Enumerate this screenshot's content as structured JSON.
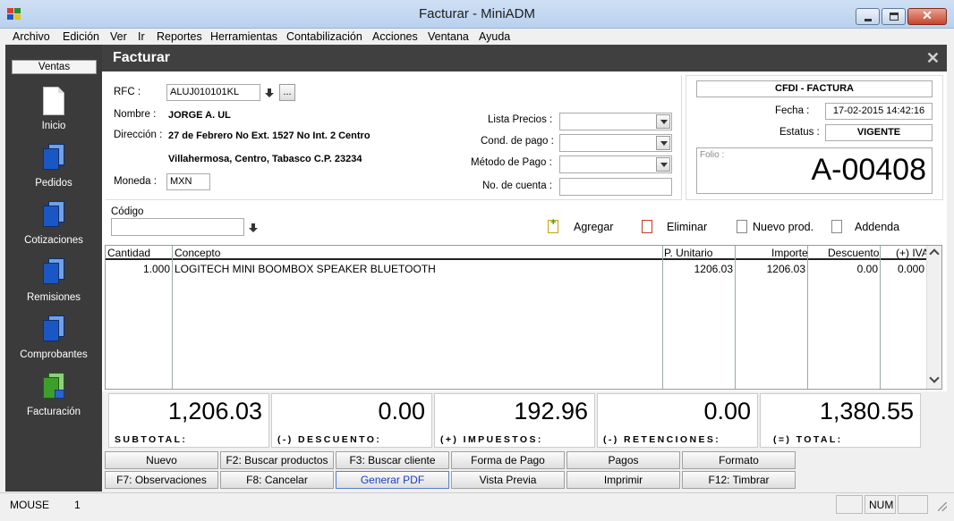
{
  "window": {
    "title": "Facturar - MiniADM"
  },
  "menu": [
    "Archivo",
    "Edición",
    "Ver",
    "Ir",
    "Reportes",
    "Herramientas",
    "Contabilización",
    "Acciones",
    "Ventana",
    "Ayuda"
  ],
  "sidebar": {
    "header": "Ventas",
    "items": [
      {
        "label": "Inicio",
        "icon": "document-icon"
      },
      {
        "label": "Pedidos",
        "icon": "pages-icon"
      },
      {
        "label": "Cotizaciones",
        "icon": "pages-icon"
      },
      {
        "label": "Remisiones",
        "icon": "pages-icon"
      },
      {
        "label": "Comprobantes",
        "icon": "pages-icon"
      },
      {
        "label": "Facturación",
        "icon": "invoice-icon"
      }
    ]
  },
  "page": {
    "title": "Facturar",
    "close_glyph": "✕"
  },
  "customer": {
    "rfc_label": "RFC :",
    "rfc": "ALUJ010101KL",
    "browse_label": "...",
    "name_label": "Nombre :",
    "name": "JORGE A. UL",
    "address_label": "Dirección :",
    "address_line1": "27 de Febrero No Ext. 1527 No Int. 2 Centro",
    "address_line2": "Villahermosa, Centro, Tabasco C.P. 23234",
    "currency_label": "Moneda :",
    "currency": "MXN"
  },
  "options": {
    "price_list_label": "Lista Precios :",
    "payment_terms_label": "Cond. de pago :",
    "payment_method_label": "Método de Pago :",
    "account_label": "No. de cuenta :"
  },
  "cfdi": {
    "type": "CFDI - FACTURA",
    "date_label": "Fecha :",
    "date": "17-02-2015 14:42:16",
    "status_label": "Estatus :",
    "status": "VIGENTE",
    "folio_label": "Folio :",
    "folio": "A-00408"
  },
  "entry": {
    "code_label": "Código"
  },
  "toolbar": {
    "add": "Agregar",
    "remove": "Eliminar",
    "new_product": "Nuevo prod.",
    "addenda": "Addenda"
  },
  "grid": {
    "columns": [
      "Cantidad",
      "Concepto",
      "P. Unitario",
      "Importe",
      "Descuento",
      "(+) IVA"
    ],
    "rows": [
      {
        "qty": "1.000",
        "concept": "LOGITECH MINI BOOMBOX SPEAKER BLUETOOTH",
        "unit_price": "1206.03",
        "amount": "1206.03",
        "discount": "0.00",
        "iva": "0.000"
      }
    ]
  },
  "totals": [
    {
      "value": "1,206.03",
      "label": "SUBTOTAL:"
    },
    {
      "value": "0.00",
      "label": "(-) DESCUENTO:"
    },
    {
      "value": "192.96",
      "label": "(+) IMPUESTOS:"
    },
    {
      "value": "0.00",
      "label": "(-) RETENCIONES:"
    },
    {
      "value": "1,380.55",
      "label": "(=) TOTAL:"
    }
  ],
  "actions": [
    [
      "Nuevo",
      "F2: Buscar productos",
      "F3: Buscar cliente",
      "Forma de Pago",
      "Pagos",
      "Formato"
    ],
    [
      "F7: Observaciones",
      "F8: Cancelar",
      "Generar PDF",
      "Vista Previa",
      "Imprimir",
      "F12:  Timbrar"
    ]
  ],
  "statusbar": {
    "mode": "MOUSE",
    "value": "1",
    "num": "NUM"
  },
  "colors": {
    "sidebar": "#3b3b3b",
    "header": "#404040",
    "link": "#1a3fc0"
  }
}
